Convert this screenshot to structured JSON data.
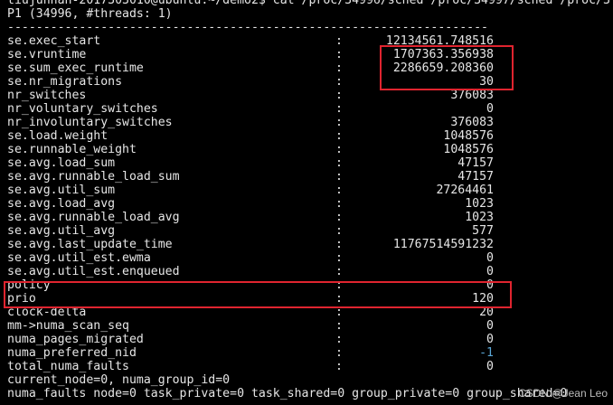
{
  "terminal": {
    "command_line": "tiujunnan-2017303010@ubuntu:~/demo2$ cat /proc/34996/sched /proc/34997/sched /proc/3",
    "process_header": "P1 (34996, #threads: 1)",
    "separator": "-------------------------------------------------------------------",
    "rows": [
      {
        "key": "se.exec_start",
        "value": "12134561.748516"
      },
      {
        "key": "se.vruntime",
        "value": "1707363.356938"
      },
      {
        "key": "se.sum_exec_runtime",
        "value": "2286659.208360"
      },
      {
        "key": "se.nr_migrations",
        "value": "30"
      },
      {
        "key": "nr_switches",
        "value": "376083"
      },
      {
        "key": "nr_voluntary_switches",
        "value": "0"
      },
      {
        "key": "nr_involuntary_switches",
        "value": "376083"
      },
      {
        "key": "se.load.weight",
        "value": "1048576"
      },
      {
        "key": "se.runnable_weight",
        "value": "1048576"
      },
      {
        "key": "se.avg.load_sum",
        "value": "47157"
      },
      {
        "key": "se.avg.runnable_load_sum",
        "value": "47157"
      },
      {
        "key": "se.avg.util_sum",
        "value": "27264461"
      },
      {
        "key": "se.avg.load_avg",
        "value": "1023"
      },
      {
        "key": "se.avg.runnable_load_avg",
        "value": "1023"
      },
      {
        "key": "se.avg.util_avg",
        "value": "577"
      },
      {
        "key": "se.avg.last_update_time",
        "value": "11767514591232"
      },
      {
        "key": "se.avg.util_est.ewma",
        "value": "0"
      },
      {
        "key": "se.avg.util_est.enqueued",
        "value": "0"
      },
      {
        "key": "policy",
        "value": "0"
      },
      {
        "key": "prio",
        "value": "120"
      },
      {
        "key": "clock-delta",
        "value": "20"
      },
      {
        "key": "mm->numa_scan_seq",
        "value": "0"
      },
      {
        "key": "numa_pages_migrated",
        "value": "0"
      },
      {
        "key": "numa_preferred_nid",
        "value": "-1"
      },
      {
        "key": "total_numa_faults",
        "value": "0"
      }
    ],
    "colon": ":",
    "footer_lines": [
      "current_node=0, numa_group_id=0",
      "numa_faults node=0 task_private=0 task_shared=0 group_private=0 group_shared=0"
    ]
  },
  "highlight_color": "#e0242f",
  "watermark": "CSDN @Jean Leo"
}
